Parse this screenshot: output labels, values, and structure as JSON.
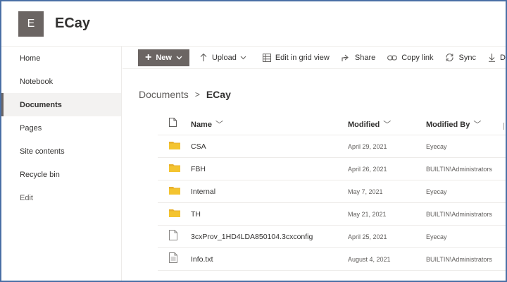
{
  "site": {
    "logo_letter": "E",
    "title": "ECay"
  },
  "nav": {
    "items": [
      {
        "label": "Home"
      },
      {
        "label": "Notebook"
      },
      {
        "label": "Documents"
      },
      {
        "label": "Pages"
      },
      {
        "label": "Site contents"
      },
      {
        "label": "Recycle bin"
      },
      {
        "label": "Edit"
      }
    ],
    "active": "Documents"
  },
  "toolbar": {
    "new_label": "New",
    "upload_label": "Upload",
    "grid_label": "Edit in grid view",
    "share_label": "Share",
    "copy_link_label": "Copy link",
    "sync_label": "Sync",
    "download_label": "Down"
  },
  "breadcrumb": {
    "root": "Documents",
    "separator": ">",
    "current": "ECay"
  },
  "table": {
    "headers": {
      "name": "Name",
      "modified": "Modified",
      "modified_by": "Modified By"
    },
    "rows": [
      {
        "type": "folder",
        "name": "CSA",
        "modified": "April 29, 2021",
        "modified_by": "Eyecay"
      },
      {
        "type": "folder",
        "name": "FBH",
        "modified": "April 26, 2021",
        "modified_by": "BUILTIN\\Administrators"
      },
      {
        "type": "folder",
        "name": "Internal",
        "modified": "May 7, 2021",
        "modified_by": "Eyecay"
      },
      {
        "type": "folder",
        "name": "TH",
        "modified": "May 21, 2021",
        "modified_by": "BUILTIN\\Administrators"
      },
      {
        "type": "file",
        "name": "3cxProv_1HD4LDA850104.3cxconfig",
        "modified": "April 25, 2021",
        "modified_by": "Eyecay"
      },
      {
        "type": "text",
        "name": "Info.txt",
        "modified": "August 4, 2021",
        "modified_by": "BUILTIN\\Administrators"
      }
    ]
  },
  "colors": {
    "accent": "#6b6563",
    "folder": "#f4c430",
    "frame": "#4a6fa5"
  }
}
